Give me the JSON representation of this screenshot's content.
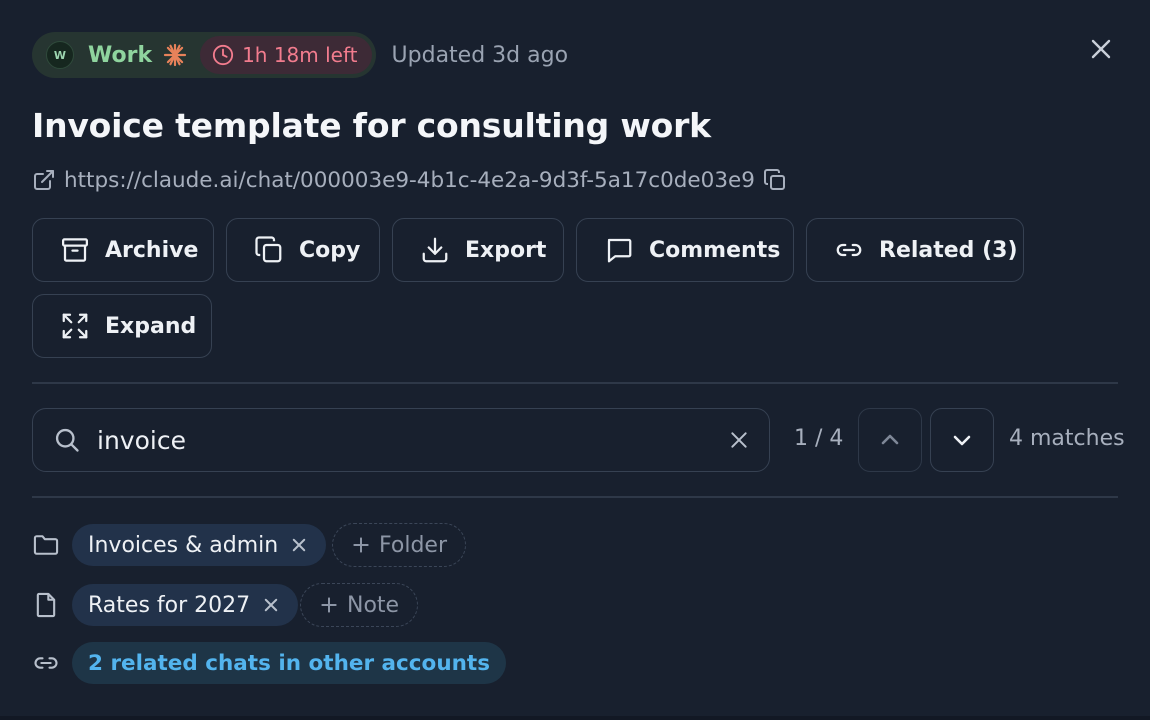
{
  "header": {
    "account_initial": "W",
    "account_name": "Work",
    "timer": "1h 18m left",
    "updated": "Updated 3d ago"
  },
  "title": "Invoice template for consulting work",
  "url": "https://claude.ai/chat/000003e9-4b1c-4e2a-9d3f-5a17c0de03e9",
  "actions": {
    "archive": "Archive",
    "copy": "Copy",
    "export": "Export",
    "comments": "Comments",
    "related": "Related (3)",
    "expand": "Expand"
  },
  "search": {
    "value": "invoice",
    "position": "1 / 4",
    "count": "4 matches"
  },
  "folder": {
    "tag": "Invoices & admin",
    "add_label": "Folder"
  },
  "note": {
    "tag": "Rates for 2027",
    "add_label": "Note"
  },
  "related_link": "2 related chats in other accounts",
  "colors": {
    "background": "#18202e",
    "accent_green": "#8fd49e",
    "timer_red": "#f27c8e",
    "link_blue": "#53b4ee",
    "spark_orange": "#e8825a"
  },
  "icons": [
    "archive-icon",
    "copy-icon",
    "export-icon",
    "comments-icon",
    "link-icon",
    "expand-icon",
    "search-icon",
    "folder-icon",
    "note-icon",
    "close-icon",
    "clock-icon",
    "spark-icon",
    "external-link-icon",
    "chevron-up-icon",
    "chevron-down-icon",
    "plus-icon"
  ]
}
